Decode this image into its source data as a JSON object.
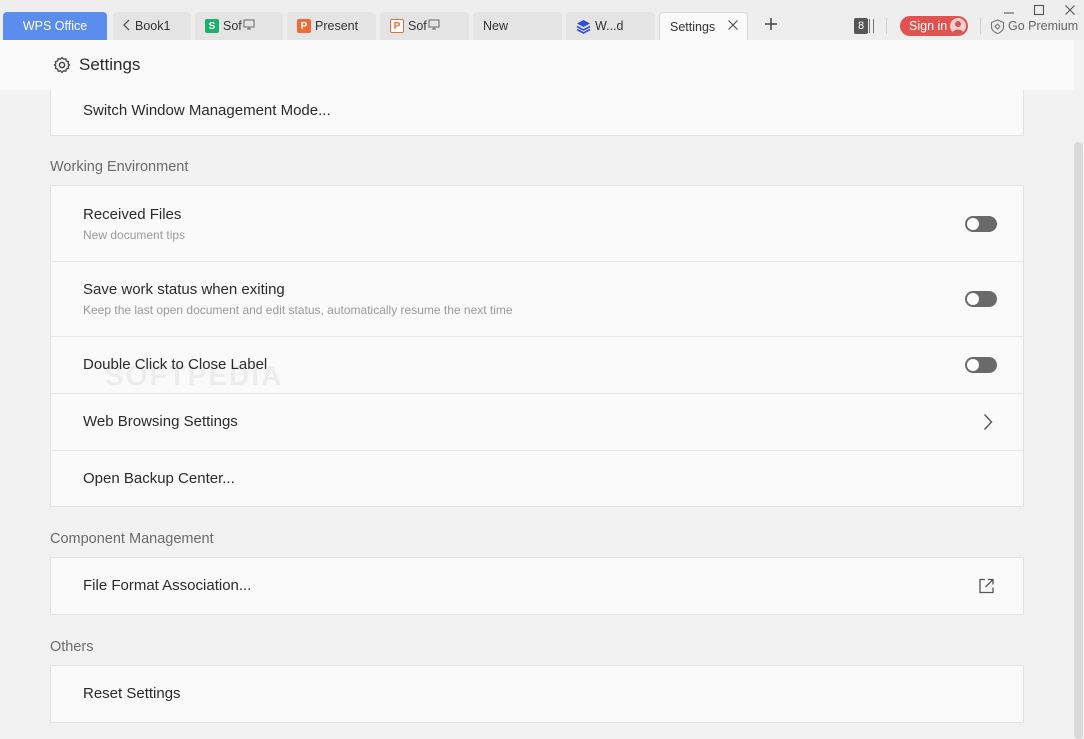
{
  "tabs": {
    "brand": "WPS Office",
    "items": [
      {
        "label": "Book1",
        "icon": "back-arrow-icon"
      },
      {
        "label": "Sof",
        "icon": "spreadsheet-icon",
        "icon_letter": "S",
        "icon_color": "#1bb06b"
      },
      {
        "label": "Present",
        "icon": "presentation-icon",
        "icon_letter": "P",
        "icon_color": "#f06a35"
      },
      {
        "label": "Sof",
        "icon": "presentation-outline-icon",
        "icon_letter": "P",
        "icon_color": "#f06a35"
      },
      {
        "label": "New",
        "icon": ""
      },
      {
        "label": "W...d",
        "icon": "layers-icon",
        "icon_color": "#2c4fd8"
      },
      {
        "label": "Settings",
        "icon": "",
        "active": true
      }
    ]
  },
  "toolbar": {
    "window_count": "8",
    "signin_label": "Sign in",
    "premium_label": "Go Premium"
  },
  "header": {
    "title": "Settings"
  },
  "sections": {
    "top_row": {
      "label": "Switch Window Management Mode..."
    },
    "working_environment": {
      "title": "Working Environment",
      "rows": [
        {
          "label": "Received Files",
          "sub": "New document tips",
          "control": "toggle",
          "on": false
        },
        {
          "label": "Save work status when exiting",
          "sub": "Keep the last open document and edit status, automatically resume the next time",
          "control": "toggle",
          "on": false
        },
        {
          "label": "Double Click to Close Label",
          "control": "toggle",
          "on": false
        },
        {
          "label": "Web Browsing Settings",
          "control": "chevron"
        },
        {
          "label": "Open Backup Center..."
        }
      ]
    },
    "component_management": {
      "title": "Component Management",
      "rows": [
        {
          "label": "File Format Association...",
          "control": "external-link"
        }
      ]
    },
    "others": {
      "title": "Others",
      "rows": [
        {
          "label": "Reset Settings"
        }
      ]
    }
  },
  "colors": {
    "brand_tab": "#5b8def",
    "signin": "#e0534f",
    "toggle_off": "#6a6a6a"
  }
}
